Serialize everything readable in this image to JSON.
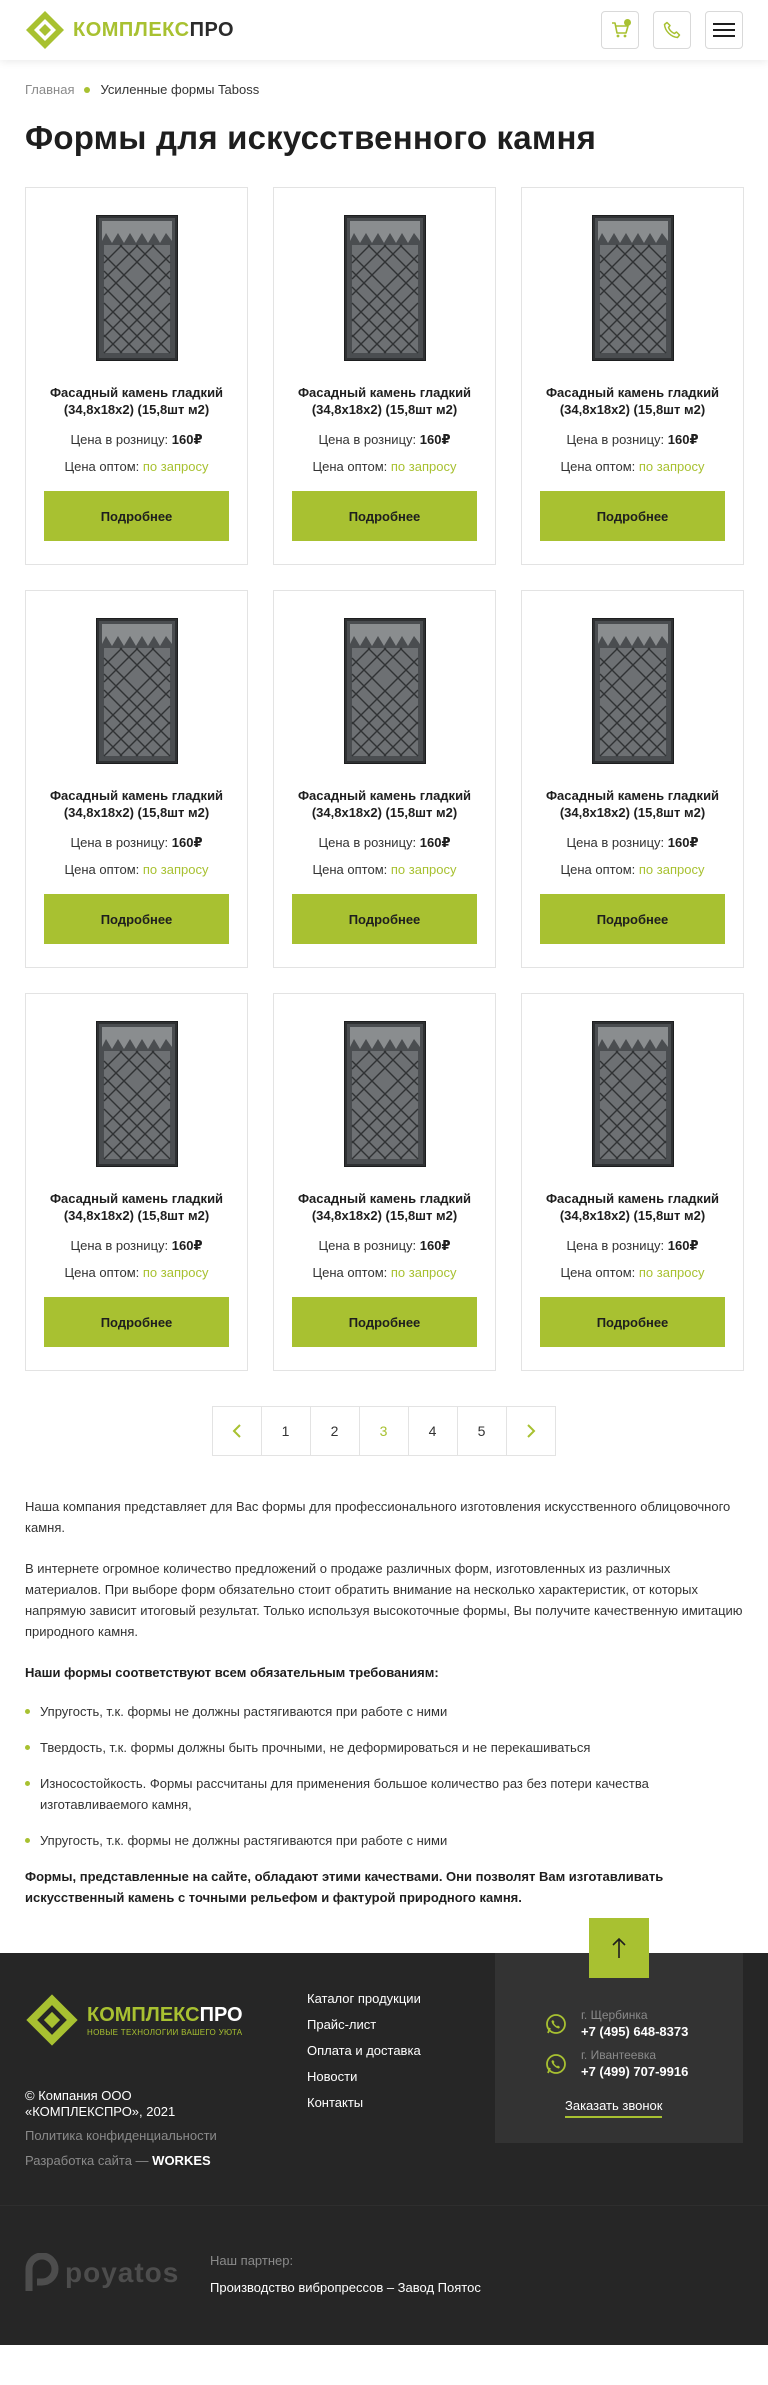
{
  "header": {
    "logo_part1": "КОМПЛЕКС",
    "logo_part2": "ПРО",
    "colors": {
      "accent": "#a8c131",
      "dark": "#262626"
    }
  },
  "breadcrumb": {
    "home": "Главная",
    "current": "Усиленные формы Taboss"
  },
  "page_title": "Формы для искусственного камня",
  "products": [
    {
      "title": "Фасадный камень гладкий (34,8х18х2) (15,8шт м2)",
      "retail_label": "Цена в розницу:",
      "retail_price": "160₽",
      "wholesale_label": "Цена оптом:",
      "wholesale_value": "по запросу",
      "button": "Подробнее"
    },
    {
      "title": "Фасадный камень гладкий (34,8х18х2) (15,8шт м2)",
      "retail_label": "Цена в розницу:",
      "retail_price": "160₽",
      "wholesale_label": "Цена оптом:",
      "wholesale_value": "по запросу",
      "button": "Подробнее"
    },
    {
      "title": "Фасадный камень гладкий (34,8х18х2) (15,8шт м2)",
      "retail_label": "Цена в розницу:",
      "retail_price": "160₽",
      "wholesale_label": "Цена оптом:",
      "wholesale_value": "по запросу",
      "button": "Подробнее"
    },
    {
      "title": "Фасадный камень гладкий (34,8х18х2) (15,8шт м2)",
      "retail_label": "Цена в розницу:",
      "retail_price": "160₽",
      "wholesale_label": "Цена оптом:",
      "wholesale_value": "по запросу",
      "button": "Подробнее"
    },
    {
      "title": "Фасадный камень гладкий (34,8х18х2) (15,8шт м2)",
      "retail_label": "Цена в розницу:",
      "retail_price": "160₽",
      "wholesale_label": "Цена оптом:",
      "wholesale_value": "по запросу",
      "button": "Подробнее"
    },
    {
      "title": "Фасадный камень гладкий (34,8х18х2) (15,8шт м2)",
      "retail_label": "Цена в розницу:",
      "retail_price": "160₽",
      "wholesale_label": "Цена оптом:",
      "wholesale_value": "по запросу",
      "button": "Подробнее"
    },
    {
      "title": "Фасадный камень гладкий (34,8х18х2) (15,8шт м2)",
      "retail_label": "Цена в розницу:",
      "retail_price": "160₽",
      "wholesale_label": "Цена оптом:",
      "wholesale_value": "по запросу",
      "button": "Подробнее"
    },
    {
      "title": "Фасадный камень гладкий (34,8х18х2) (15,8шт м2)",
      "retail_label": "Цена в розницу:",
      "retail_price": "160₽",
      "wholesale_label": "Цена оптом:",
      "wholesale_value": "по запросу",
      "button": "Подробнее"
    },
    {
      "title": "Фасадный камень гладкий (34,8х18х2) (15,8шт м2)",
      "retail_label": "Цена в розницу:",
      "retail_price": "160₽",
      "wholesale_label": "Цена оптом:",
      "wholesale_value": "по запросу",
      "button": "Подробнее"
    }
  ],
  "pagination": {
    "pages": [
      "1",
      "2",
      "3",
      "4",
      "5"
    ],
    "current": "3",
    "prev_icon": "chevron-left-icon",
    "next_icon": "chevron-right-icon"
  },
  "content": {
    "p1": "Наша компания представляет для Вас формы для профессионального изготовления искусственного облицовочного камня.",
    "p2": "В интернете огромное количество предложений о продаже различных форм, изготовленных из различных материалов. При выборе форм обязательно стоит обратить внимание на несколько характеристик, от которых напрямую зависит итоговый результат. Только используя высокоточные формы, Вы получите качественную имитацию природного камня.",
    "requirements_title": "Наши формы соответствуют всем обязательным требованиям:",
    "requirements": [
      "Упругость, т.к. формы не должны растягиваются при работе с ними",
      "Твердость, т.к. формы должны быть прочными, не деформироваться и не перекашиваться",
      "Износостойкость. Формы рассчитаны для применения большое количество раз без потери качества изготавливаемого камня,",
      "Упругость, т.к. формы не должны растягиваются при работе с ними"
    ],
    "conclusion": "Формы, представленные на сайте, обладают этими качествами. Они позволят Вам изготавливать искусственный камень с точными рельефом и фактурой природного камня."
  },
  "footer": {
    "logo_part1": "КОМПЛЕКС",
    "logo_part2": "ПРО",
    "tagline": "НОВЫЕ ТЕХНОЛОГИИ ВАШЕГО УЮТА",
    "copyright_line1": "© Компания ООО",
    "copyright_line2": "«КОМПЛЕКСПРО», 2021",
    "privacy": "Политика конфиденциальности",
    "dev_label": "Разработка сайта —",
    "dev_name": "WORKES",
    "menu": [
      "Каталог продукции",
      "Прайс-лист",
      "Оплата и доставка",
      "Новости",
      "Контакты"
    ],
    "phones": [
      {
        "city": "г. Щербинка",
        "number": "+7 (495) 648-8373"
      },
      {
        "city": "г. Ивантеевка",
        "number": "+7 (499) 707-9916"
      }
    ],
    "call_link": "Заказать звонок",
    "partner_name": "poyatos",
    "partner_label": "Наш партнер:",
    "partner_desc": "Производство вибропрессов – Завод Поятос"
  }
}
